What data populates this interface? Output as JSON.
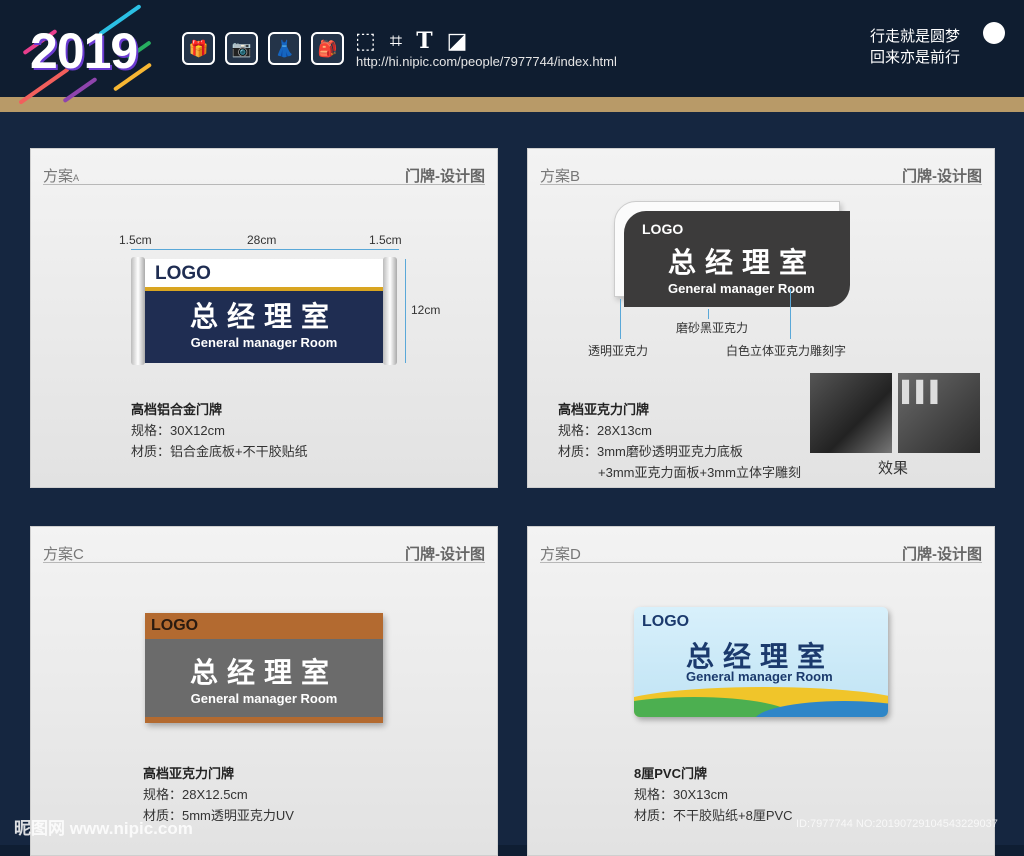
{
  "header": {
    "year": "2019",
    "url": "http://hi.nipic.com/people/7977744/index.html",
    "slogan_line1": "行走就是圆梦",
    "slogan_line2": "回来亦是前行",
    "icons": [
      "gift-icon",
      "camera-icon",
      "dress-icon",
      "backpack-icon"
    ],
    "tools": [
      "select-icon",
      "crop-icon",
      "text-icon",
      "page-curl-icon"
    ]
  },
  "cards": {
    "a": {
      "plan": "方案",
      "plan_suffix": "A",
      "category": "门牌-设计图",
      "sign_logo": "LOGO",
      "sign_title": "总经理室",
      "sign_en": "General manager Room",
      "dim_left": "1.5cm",
      "dim_mid": "28cm",
      "dim_right": "1.5cm",
      "dim_height": "12cm",
      "title": "高档铝合金门牌",
      "spec": "规格：30X12cm",
      "material": "材质：铝合金底板+不干胶贴纸"
    },
    "b": {
      "plan": "方案B",
      "category": "门牌-设计图",
      "sign_logo": "LOGO",
      "sign_title": "总经理室",
      "sign_en": "General manager Room",
      "note1": "磨砂黑亚克力",
      "note2": "透明亚克力",
      "note3": "白色立体亚克力雕刻字",
      "title": "高档亚克力门牌",
      "spec": "规格：28X13cm",
      "material": "材质：3mm磨砂透明亚克力底板",
      "material2": "+3mm亚克力面板+3mm立体字雕刻",
      "effect": "效果"
    },
    "c": {
      "plan": "方案C",
      "category": "门牌-设计图",
      "sign_logo": "LOGO",
      "sign_title": "总经理室",
      "sign_en": "General manager Room",
      "title": "高档亚克力门牌",
      "spec": "规格：28X12.5cm",
      "material": "材质：5mm透明亚克力UV"
    },
    "d": {
      "plan": "方案D",
      "category": "门牌-设计图",
      "sign_logo": "LOGO",
      "sign_title": "总经理室",
      "sign_en": "General manager Room",
      "title": "8厘PVC门牌",
      "spec": "规格：30X13cm",
      "material": "材质：不干胶贴纸+8厘PVC"
    }
  },
  "footer": {
    "watermark": "昵图网 www.nipic.com",
    "id": "ID:7977744 NO:20190729104543229037"
  }
}
